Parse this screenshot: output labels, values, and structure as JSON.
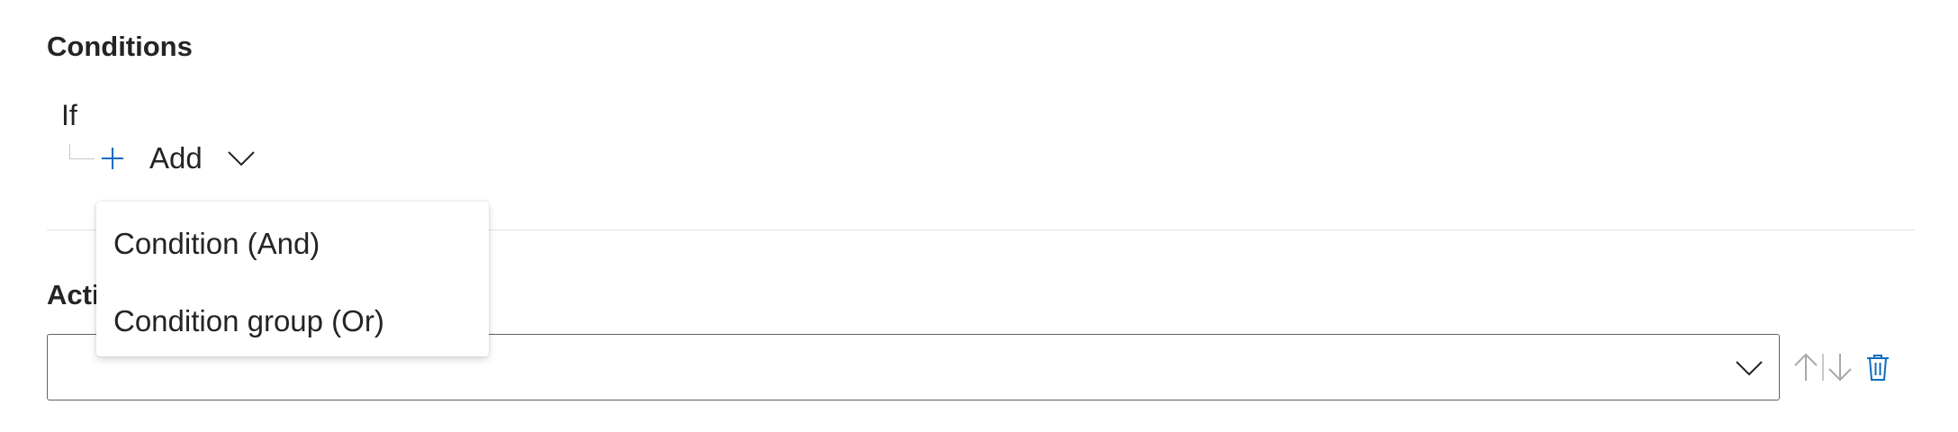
{
  "conditions": {
    "title": "Conditions",
    "if_label": "If",
    "add_label": "Add"
  },
  "actions": {
    "title": "Actions",
    "select_value": ""
  },
  "dropdown": {
    "items": [
      {
        "label": "Condition (And)"
      },
      {
        "label": "Condition group (Or)"
      }
    ]
  },
  "colors": {
    "accent": "#0f6cbd",
    "disabled": "#a8a8a8",
    "text": "#242424"
  },
  "icons": {
    "add": "plus-icon",
    "expand": "chevron-down-icon",
    "move_up": "arrow-up-icon",
    "move_down": "arrow-down-icon",
    "delete": "trash-icon"
  }
}
